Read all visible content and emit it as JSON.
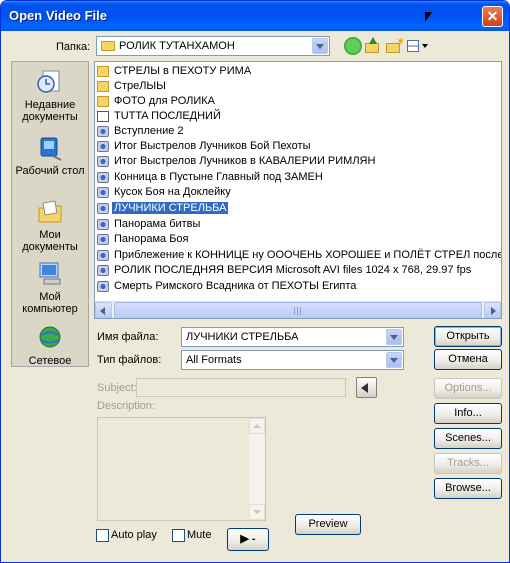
{
  "window": {
    "title": "Open Video File",
    "close_glyph": "✕"
  },
  "toolbar": {
    "look_in_label": "Папка:",
    "look_in_value": "РОЛИК  ТУТАНХАМОН",
    "icons": [
      "back-icon",
      "up-folder-icon",
      "new-folder-icon",
      "views-menu-icon"
    ]
  },
  "places": [
    {
      "label": "Недавние документы",
      "icon": "recent-documents-icon"
    },
    {
      "label": "Рабочий стол",
      "icon": "desktop-icon"
    },
    {
      "label": "Мои документы",
      "icon": "my-documents-icon"
    },
    {
      "label": "Мой компьютер",
      "icon": "my-computer-icon"
    },
    {
      "label": "Сетевое",
      "icon": "network-icon"
    }
  ],
  "files": [
    {
      "name": "СТРЕЛЫ в ПЕХОТУ РИМА",
      "type": "folder"
    },
    {
      "name": "СтреЛЫЫ",
      "type": "folder"
    },
    {
      "name": "ФОТО для РОЛИКА",
      "type": "folder"
    },
    {
      "name": "TUTTA ПОСЛЕДНИЙ",
      "type": "shortcut"
    },
    {
      "name": "Вступление 2",
      "type": "video"
    },
    {
      "name": "Итог Выстрелов Лучников Бой Пехоты",
      "type": "video"
    },
    {
      "name": "Итог Выстрелов Лучников в КАВАЛЕРИИ РИМЛЯН",
      "type": "video"
    },
    {
      "name": "Конница в Пустыне Главный под ЗАМЕН",
      "type": "video"
    },
    {
      "name": "Кусок Боя на Доклейку",
      "type": "video"
    },
    {
      "name": "ЛУЧНИКИ СТРЕЛЬБА",
      "type": "video",
      "selected": true
    },
    {
      "name": "Панорама битвы",
      "type": "video"
    },
    {
      "name": "Панорама Боя",
      "type": "video"
    },
    {
      "name": "Приблежение к КОННИЦЕ ну ОООЧЕНЬ ХОРОШЕЕ и ПОЛЁТ СТРЕЛ после выстрела Пе",
      "type": "video"
    },
    {
      "name": "РОЛИК ПОСЛЕДНЯЯ ВЕРСИЯ Microsoft AVI files 1024 x 768, 29.97 fps",
      "type": "video"
    },
    {
      "name": "Смерть Римского Всадника от ПЕХОТЫ Египта",
      "type": "video"
    }
  ],
  "form": {
    "file_name_label": "Имя файла:",
    "file_name_value": "ЛУЧНИКИ СТРЕЛЬБА",
    "file_type_label": "Тип файлов:",
    "file_type_value": "All Formats",
    "subject_label": "Subject:",
    "description_label": "Description:",
    "autoplay_label": "Auto play",
    "mute_label": "Mute"
  },
  "buttons": {
    "open": "Открыть",
    "cancel": "Отмена",
    "options": "Options...",
    "info": "Info...",
    "scenes": "Scenes...",
    "tracks": "Tracks...",
    "browse": "Browse...",
    "preview": "Preview",
    "play": "▶ -"
  },
  "colors": {
    "title_bar": "#0053ee",
    "selection": "#316ac5",
    "dialog_bg": "#ece9d8"
  }
}
